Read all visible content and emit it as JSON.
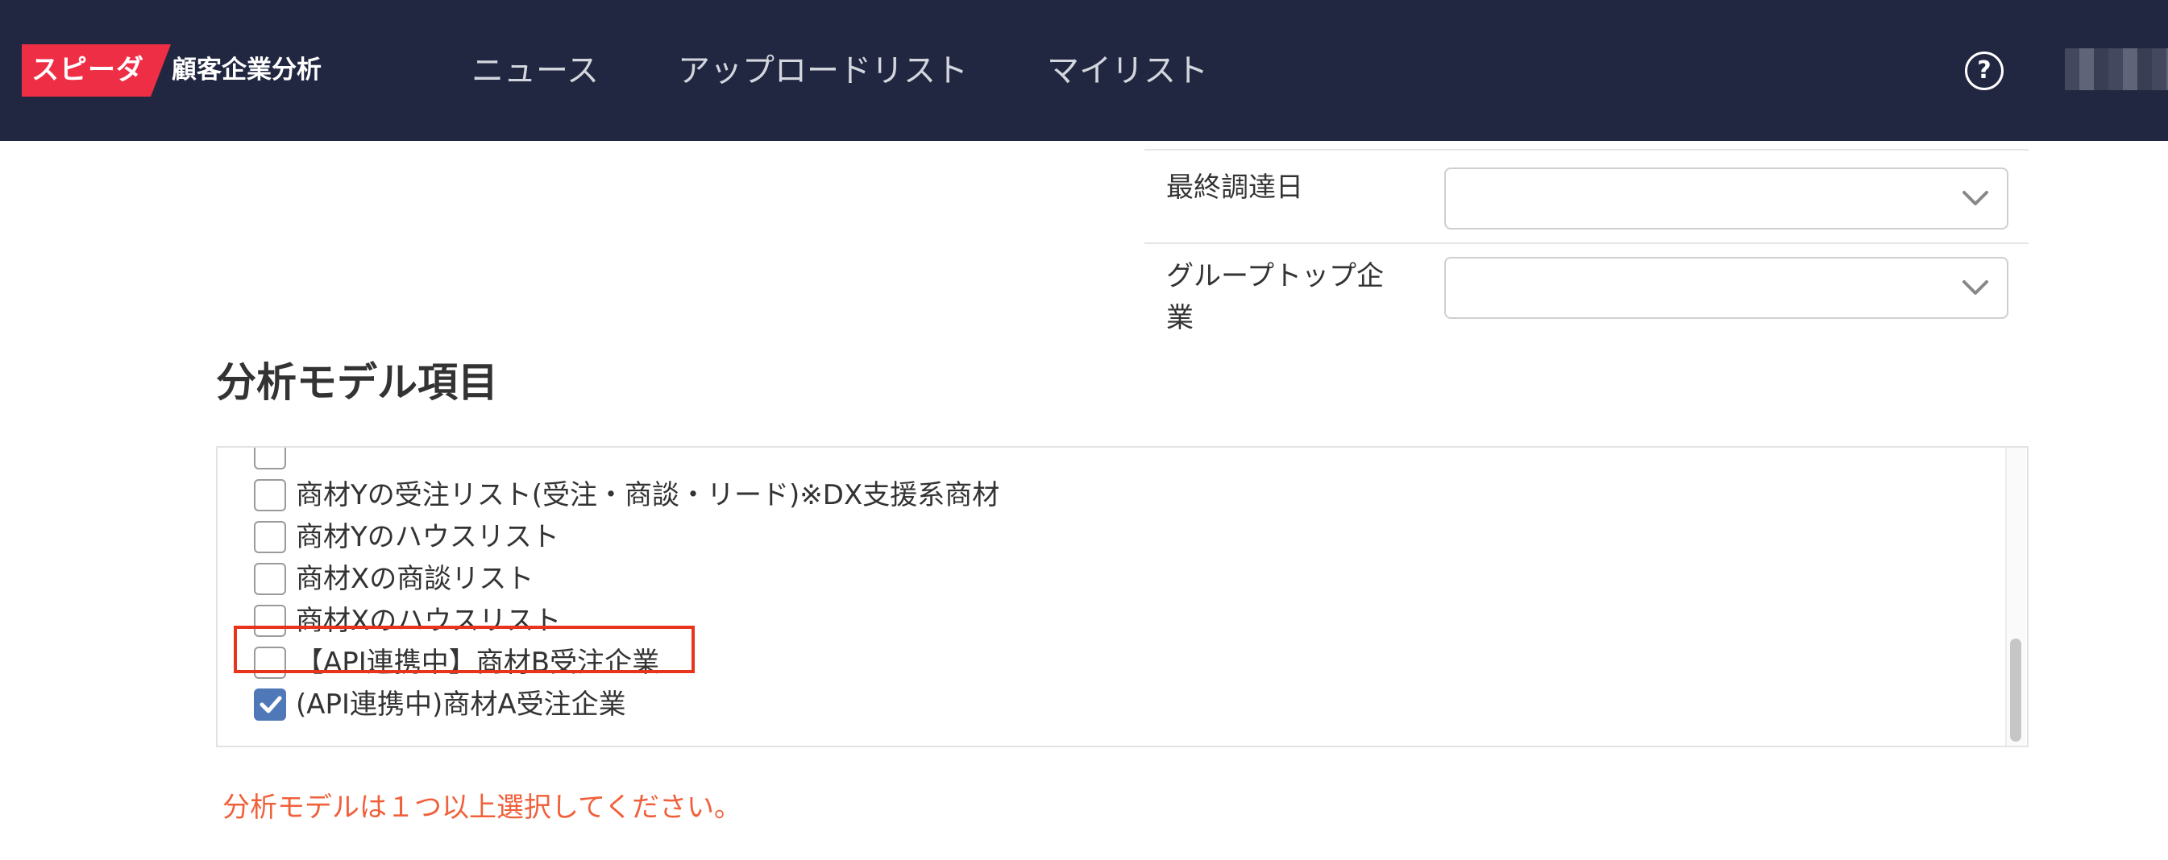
{
  "header": {
    "logo_text": "スピーダ",
    "app_name": "顧客企業分析",
    "nav": [
      {
        "label": "ニュース"
      },
      {
        "label": "アップロードリスト"
      },
      {
        "label": "マイリスト"
      }
    ],
    "help_icon": "?"
  },
  "filters": {
    "last_funding_date": {
      "label": "最終調達日",
      "value": ""
    },
    "group_top_company": {
      "label_line1": "グループトップ企",
      "label_line2": "業",
      "value": ""
    }
  },
  "analysis_model": {
    "title": "分析モデル項目",
    "options": [
      {
        "label": "",
        "checked": false
      },
      {
        "label": "商材Yの受注リスト(受注・商談・リード)※DX支援系商材",
        "checked": false
      },
      {
        "label": "商材Yのハウスリスト",
        "checked": false
      },
      {
        "label": "商材Xの商談リスト",
        "checked": false
      },
      {
        "label": "商材Xのハウスリスト",
        "checked": false
      },
      {
        "label": "【API連携中】商材B受注企業",
        "checked": false
      },
      {
        "label": "(API連携中)商材A受注企業",
        "checked": true
      }
    ],
    "error": "分析モデルは１つ以上選択してください。"
  },
  "colors": {
    "header_bg": "#222741",
    "logo_red": "#ee2e44",
    "checkbox_checked": "#4f78b8",
    "highlight_border": "#e8341c",
    "error_text": "#f0603a"
  }
}
